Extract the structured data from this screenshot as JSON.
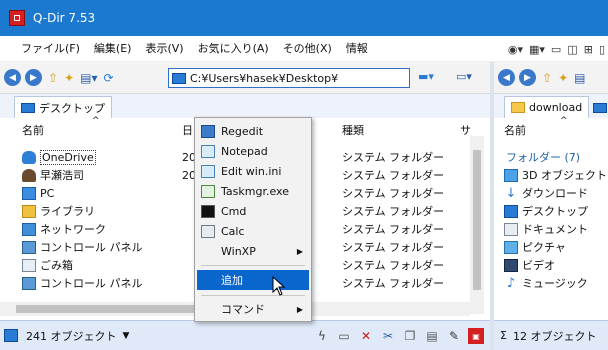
{
  "window": {
    "title": "Q-Dir 7.53"
  },
  "menu": [
    "ファイル(F)",
    "編集(E)",
    "表示(V)",
    "お気に入り(A)",
    "その他(X)",
    "情報"
  ],
  "address": {
    "path": "C:¥Users¥hasek¥Desktop¥"
  },
  "left_pane": {
    "tab_label": "デスクトップ",
    "columns": {
      "name": "名前",
      "date": "日",
      "type": "種類",
      "size": "サ"
    },
    "rows": [
      {
        "name": "OneDrive",
        "date": "20",
        "type": "システム フォルダー",
        "icon": "cloud-icon"
      },
      {
        "name": "早瀬浩司",
        "date": "20",
        "type": "システム フォルダー",
        "icon": "user-icon"
      },
      {
        "name": "PC",
        "date": "",
        "type": "システム フォルダー",
        "icon": "pc-icon"
      },
      {
        "name": "ライブラリ",
        "date": "",
        "type": "システム フォルダー",
        "icon": "library-icon"
      },
      {
        "name": "ネットワーク",
        "date": "",
        "type": "システム フォルダー",
        "icon": "network-icon"
      },
      {
        "name": "コントロール パネル",
        "date": "",
        "type": "システム フォルダー",
        "icon": "control-panel-icon"
      },
      {
        "name": "ごみ箱",
        "date": "",
        "type": "システム フォルダー",
        "icon": "recycle-bin-icon"
      },
      {
        "name": "コントロール パネル",
        "date": "",
        "type": "システム フォルダー",
        "icon": "control-panel-icon"
      }
    ],
    "status": "241 オブジェクト"
  },
  "right_pane": {
    "tab_label": "download",
    "columns": {
      "name": "名前"
    },
    "group": "フォルダー (7)",
    "rows": [
      {
        "name": "3D オブジェクト",
        "icon": "3d-object-icon"
      },
      {
        "name": "ダウンロード",
        "icon": "download-icon"
      },
      {
        "name": "デスクトップ",
        "icon": "desktop-icon"
      },
      {
        "name": "ドキュメント",
        "icon": "document-icon"
      },
      {
        "name": "ピクチャ",
        "icon": "picture-icon"
      },
      {
        "name": "ビデオ",
        "icon": "video-icon"
      },
      {
        "name": "ミュージック",
        "icon": "music-icon"
      }
    ],
    "status": "12 オブジェクト"
  },
  "context_menu": {
    "items": [
      {
        "label": "Regedit",
        "icon": "regedit-icon"
      },
      {
        "label": "Notepad",
        "icon": "notepad-icon"
      },
      {
        "label": "Edit win.ini",
        "icon": "notepad-icon"
      },
      {
        "label": "Taskmgr.exe",
        "icon": "taskmgr-icon"
      },
      {
        "label": "Cmd",
        "icon": "cmd-icon"
      },
      {
        "label": "Calc",
        "icon": "calc-icon"
      },
      {
        "label": "WinXP",
        "icon": "",
        "submenu": true
      }
    ],
    "selected": "追加",
    "command": "コマンド"
  },
  "colors": {
    "titlebar": "#1c79d0",
    "selection": "#0a66cc",
    "status_bar": "#dfe9f7"
  }
}
